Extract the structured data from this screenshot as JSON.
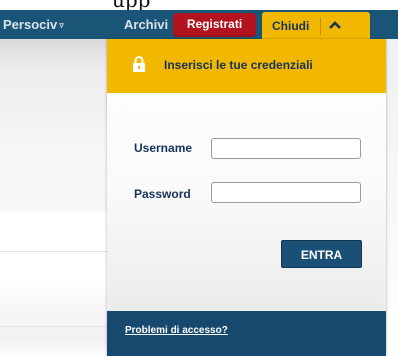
{
  "top_crop_text": "upp",
  "nav": {
    "persociv_label": "Persociv",
    "persociv_caret": "▿",
    "archivi_label": "Archivi",
    "registrati_label": "Registrati",
    "chiudi_label": "Chiudi"
  },
  "login": {
    "header_text": "Inserisci le tue credenziali",
    "username_label": "Username",
    "username_value": "",
    "password_label": "Password",
    "password_value": "",
    "submit_label": "ENTRA",
    "help_link": "Problemi di accesso?"
  },
  "colors": {
    "navbar": "#1a5577",
    "accent_yellow": "#f2b700",
    "registrati_red": "#b3131f",
    "primary_blue": "#1a4f76",
    "text_navy": "#17335a"
  },
  "icons": {
    "lock": "lock-icon",
    "chevron": "chevron-up-icon"
  }
}
